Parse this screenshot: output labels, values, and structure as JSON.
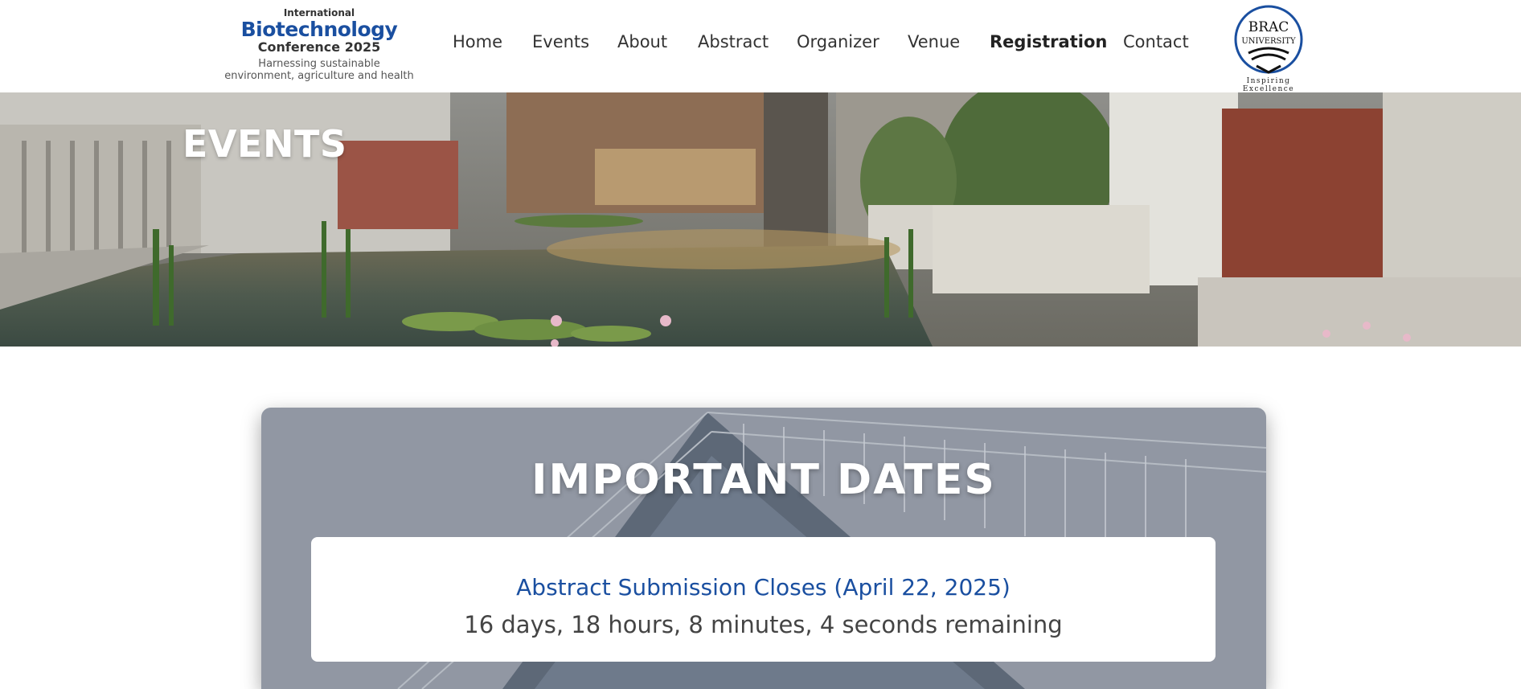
{
  "header": {
    "logo": {
      "line1": "International",
      "line2": "Biotechnology",
      "line3": "Conference 2025",
      "line4a": "Harnessing sustainable",
      "line4b": "environment, agriculture and health"
    },
    "nav": [
      {
        "label": "Home"
      },
      {
        "label": "Events"
      },
      {
        "label": "About"
      },
      {
        "label": "Abstract"
      },
      {
        "label": "Organizer"
      },
      {
        "label": "Venue"
      },
      {
        "label": "Registration"
      },
      {
        "label": "Contact"
      }
    ],
    "partner_logo": {
      "line1": "BRAC",
      "line2": "UNIVERSITY",
      "tagline": "Inspiring Excellence"
    }
  },
  "hero": {
    "title": "EVENTS"
  },
  "important_dates": {
    "title": "IMPORTANT DATES",
    "countdown": {
      "label": "Abstract Submission Closes (April 22, 2025)",
      "remaining": "16 days, 18 hours, 8 minutes, 4 seconds remaining"
    }
  },
  "colors": {
    "brand_blue": "#1a4fa0",
    "text_dark": "#333333",
    "white": "#ffffff"
  }
}
